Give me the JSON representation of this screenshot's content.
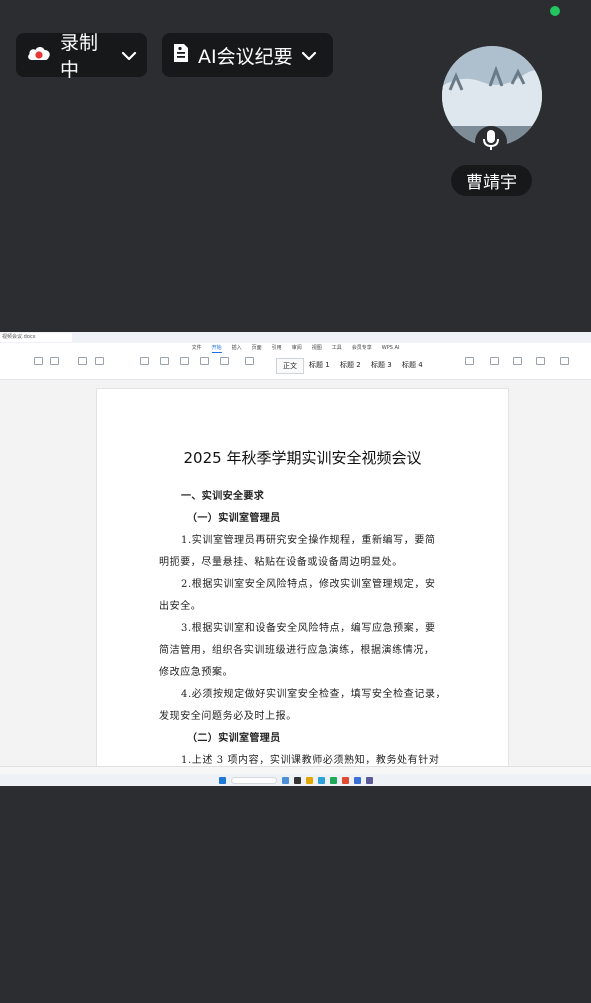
{
  "recording": {
    "label": "录制中",
    "icon": "cloud-record-icon"
  },
  "ai_summary": {
    "label": "AI会议纪要",
    "icon": "document-icon"
  },
  "participant": {
    "name": "曹靖宇",
    "mic_icon": "microphone-icon"
  },
  "colors": {
    "background": "#2b2d30",
    "pill": "#17181a",
    "online": "#22c55e",
    "record_red": "#e53935",
    "accent": "#1e6ee8"
  },
  "shared_screen": {
    "tab_title": "视频会议.docx",
    "menu": [
      "文件",
      "开始",
      "插入",
      "页面",
      "引用",
      "审阅",
      "视图",
      "工具",
      "会员专享",
      "WPS AI"
    ],
    "styles": [
      "正文",
      "标题 1",
      "标题 2",
      "标题 3",
      "标题 4"
    ],
    "document": {
      "title": "2025 年秋季学期实训安全视频会议",
      "lines": [
        "一、实训安全要求",
        "（一）实训室管理员",
        "1.实训室管理员再研究安全操作规程，重新编写，要简",
        "明扼要，尽量悬挂、粘贴在设备或设备周边明显处。",
        "2.根据实训室安全风险特点，修改实训室管理规定，安",
        "出安全。",
        "3.根据实训室和设备安全风险特点，编写应急预案，要",
        "简洁管用，组织各实训班级进行应急演练，根据演练情况，",
        "修改应急预案。",
        "4.必须按规定做好实训室安全检查，填写安全检查记录，",
        "发现安全问题务必及时上报。",
        "（二）实训室管理员",
        "1.上述 3 项内容，实训课教师必须熟知，教务处有针对"
      ]
    }
  }
}
